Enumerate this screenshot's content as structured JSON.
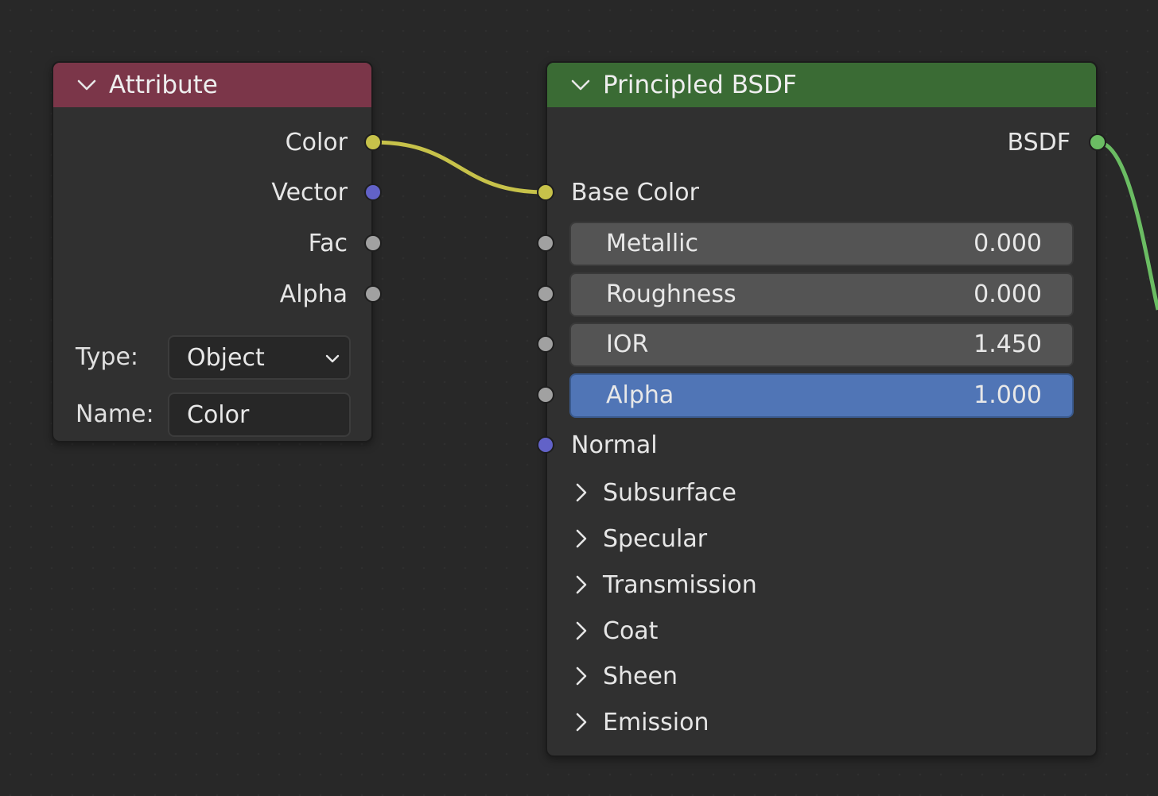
{
  "colors": {
    "attribute_header": "#7b3649",
    "bsdf_header": "#3a6b34",
    "socket_color": "#c7c24a",
    "socket_vector": "#6262c8",
    "socket_float": "#a1a1a1",
    "socket_shader": "#6bbd63",
    "field_active": "#5075b6"
  },
  "attribute_node": {
    "title": "Attribute",
    "collapse_icon": "chevron-down-icon",
    "outputs": [
      {
        "label": "Color",
        "socket": "color"
      },
      {
        "label": "Vector",
        "socket": "vector"
      },
      {
        "label": "Fac",
        "socket": "float"
      },
      {
        "label": "Alpha",
        "socket": "float"
      }
    ],
    "type_label": "Type:",
    "type_value": "Object",
    "name_label": "Name:",
    "name_value": "Color"
  },
  "bsdf_node": {
    "title": "Principled BSDF",
    "collapse_icon": "chevron-down-icon",
    "output_label": "BSDF",
    "base_color_label": "Base Color",
    "fields": [
      {
        "label": "Metallic",
        "value": "0.000",
        "active": false
      },
      {
        "label": "Roughness",
        "value": "0.000",
        "active": false
      },
      {
        "label": "IOR",
        "value": "1.450",
        "active": false
      },
      {
        "label": "Alpha",
        "value": "1.000",
        "active": true
      }
    ],
    "normal_label": "Normal",
    "panels": [
      "Subsurface",
      "Specular",
      "Transmission",
      "Coat",
      "Sheen",
      "Emission"
    ],
    "panel_icon": "chevron-right-icon"
  }
}
